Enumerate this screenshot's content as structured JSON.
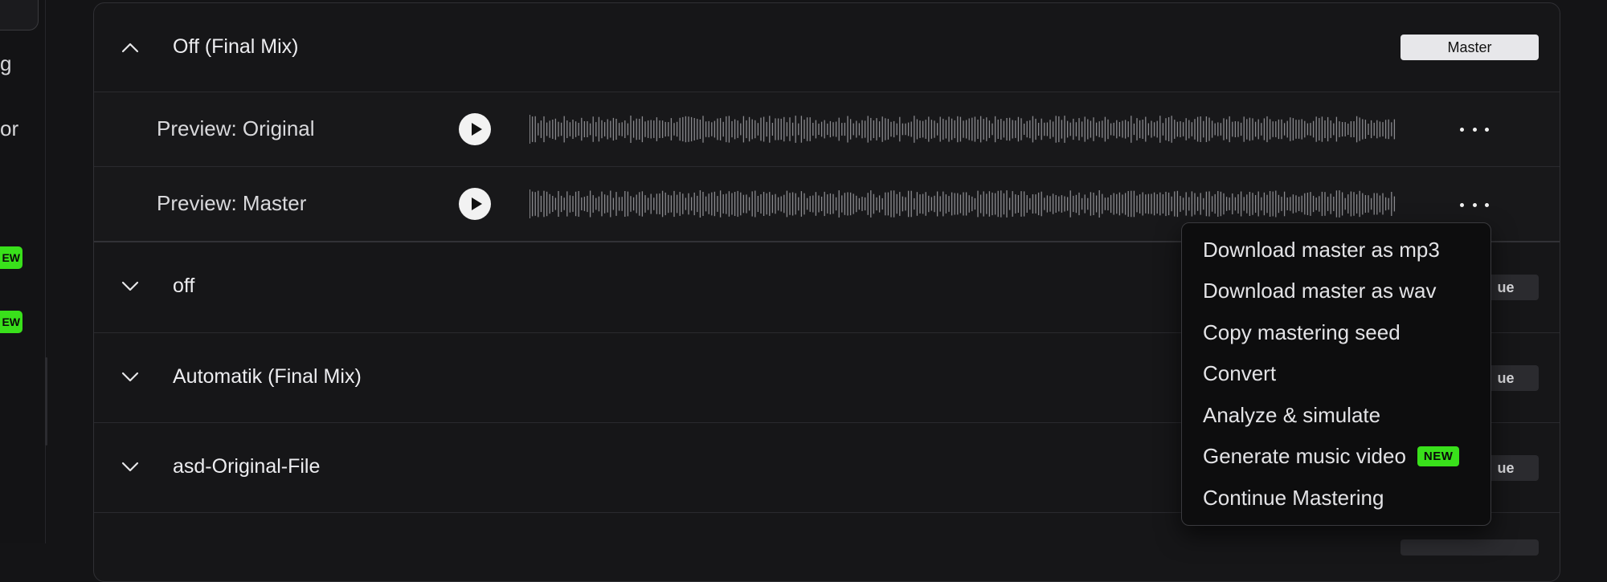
{
  "sidebar": {
    "items": [
      {
        "text": "g"
      },
      {
        "text": "or"
      }
    ],
    "badges": [
      "EW",
      "EW"
    ]
  },
  "groups": [
    {
      "title": "Off (Final Mix)",
      "expanded": true,
      "action_label": "Master"
    },
    {
      "title": "off",
      "expanded": false,
      "action_label": "ue"
    },
    {
      "title": "Automatik (Final Mix)",
      "expanded": false,
      "action_label": "ue"
    },
    {
      "title": "asd-Original-File",
      "expanded": false,
      "action_label": "ue"
    }
  ],
  "tracks": [
    {
      "label": "Preview: Original"
    },
    {
      "label": "Preview: Master"
    }
  ],
  "menu": {
    "items": [
      {
        "label": "Download master as mp3"
      },
      {
        "label": "Download master as wav"
      },
      {
        "label": "Copy mastering seed"
      },
      {
        "label": "Convert"
      },
      {
        "label": "Analyze & simulate"
      },
      {
        "label": "Generate music video",
        "badge": "NEW"
      },
      {
        "label": "Continue Mastering"
      }
    ]
  },
  "colors": {
    "accent_new": "#39e01b",
    "background": "#141416",
    "panel": "#161618",
    "menu_bg": "#0d0d0e"
  }
}
